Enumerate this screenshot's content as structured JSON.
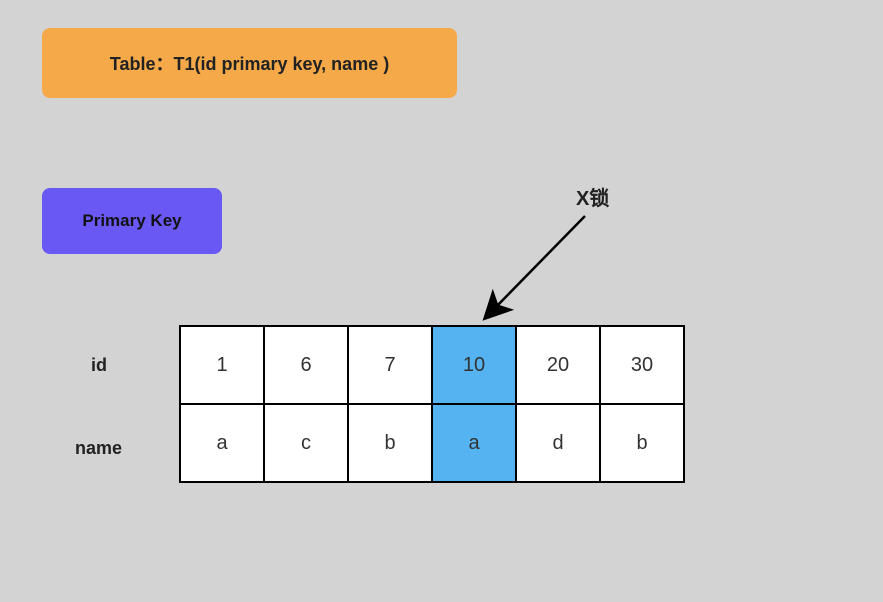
{
  "title": "Table：T1(id  primary  key, name )",
  "primary_key_label": "Primary  Key",
  "lock_label": "X锁",
  "row_labels": {
    "id": "id",
    "name": "name"
  },
  "table": {
    "highlighted_index": 3,
    "rows": [
      {
        "key": "id",
        "cells": [
          "1",
          "6",
          "7",
          "10",
          "20",
          "30"
        ]
      },
      {
        "key": "name",
        "cells": [
          "a",
          "c",
          "b",
          "a",
          "d",
          "b"
        ]
      }
    ]
  },
  "colors": {
    "background": "#d3d3d3",
    "title_banner": "#f5a949",
    "primary_key_box": "#6a58f4",
    "highlight": "#54b3f0"
  }
}
